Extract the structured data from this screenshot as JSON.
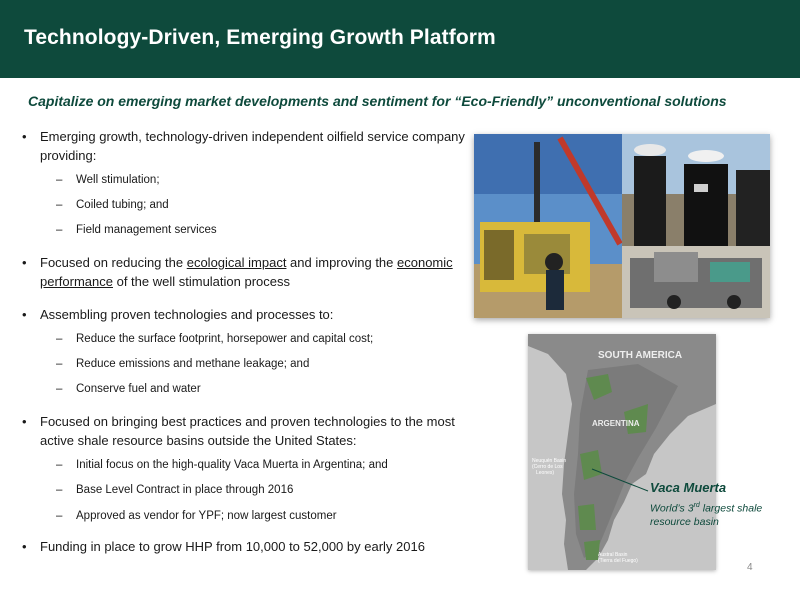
{
  "header": {
    "title": "Technology-Driven, Emerging Growth Platform"
  },
  "subtitle": "Capitalize on emerging market developments and sentiment for “Eco-Friendly” unconventional solutions",
  "bullets": [
    {
      "text": "Emerging growth, technology-driven independent oilfield service company providing:",
      "subs": [
        "Well stimulation;",
        "Coiled tubing; and",
        "Field management services"
      ]
    },
    {
      "pre": "Focused on reducing the ",
      "u1": "ecological impact",
      "mid": " and improving the ",
      "u2": "economic performance",
      "post": " of the well stimulation process"
    },
    {
      "text": "Assembling proven technologies and processes to:",
      "subs": [
        "Reduce the surface footprint, horsepower and capital cost;",
        "Reduce emissions and methane leakage; and",
        "Conserve fuel and water"
      ]
    },
    {
      "text": "Focused on bringing best practices and proven technologies to the most active shale resource basins outside the United States:",
      "subs": [
        "Initial focus on the high-quality Vaca Muerta in Argentina; and",
        "Base Level Contract in place through 2016",
        "Approved as vendor for YPF; now largest customer"
      ]
    },
    {
      "text": "Funding in place to grow HHP from 10,000 to 52,000 by early 2016"
    }
  ],
  "map": {
    "continent_label": "SOUTH AMERICA",
    "country_label": "ARGENTINA",
    "basin_1_line1": "Neuquén Basin",
    "basin_1_line2": "(Cerro de Los",
    "basin_1_line3": "Leones)",
    "basin_2_line1": "Austral Basin",
    "basin_2_line2": "(Tierra del Fuego)"
  },
  "callout": {
    "title": "Vaca Muerta",
    "sub_pre": "World’s 3",
    "sub_sup": "rd",
    "sub_post": " largest shale resource basin"
  },
  "page_number": "4",
  "colors": {
    "brand_green": "#0e4a3c",
    "map_basin_green": "#5f8a4f"
  }
}
